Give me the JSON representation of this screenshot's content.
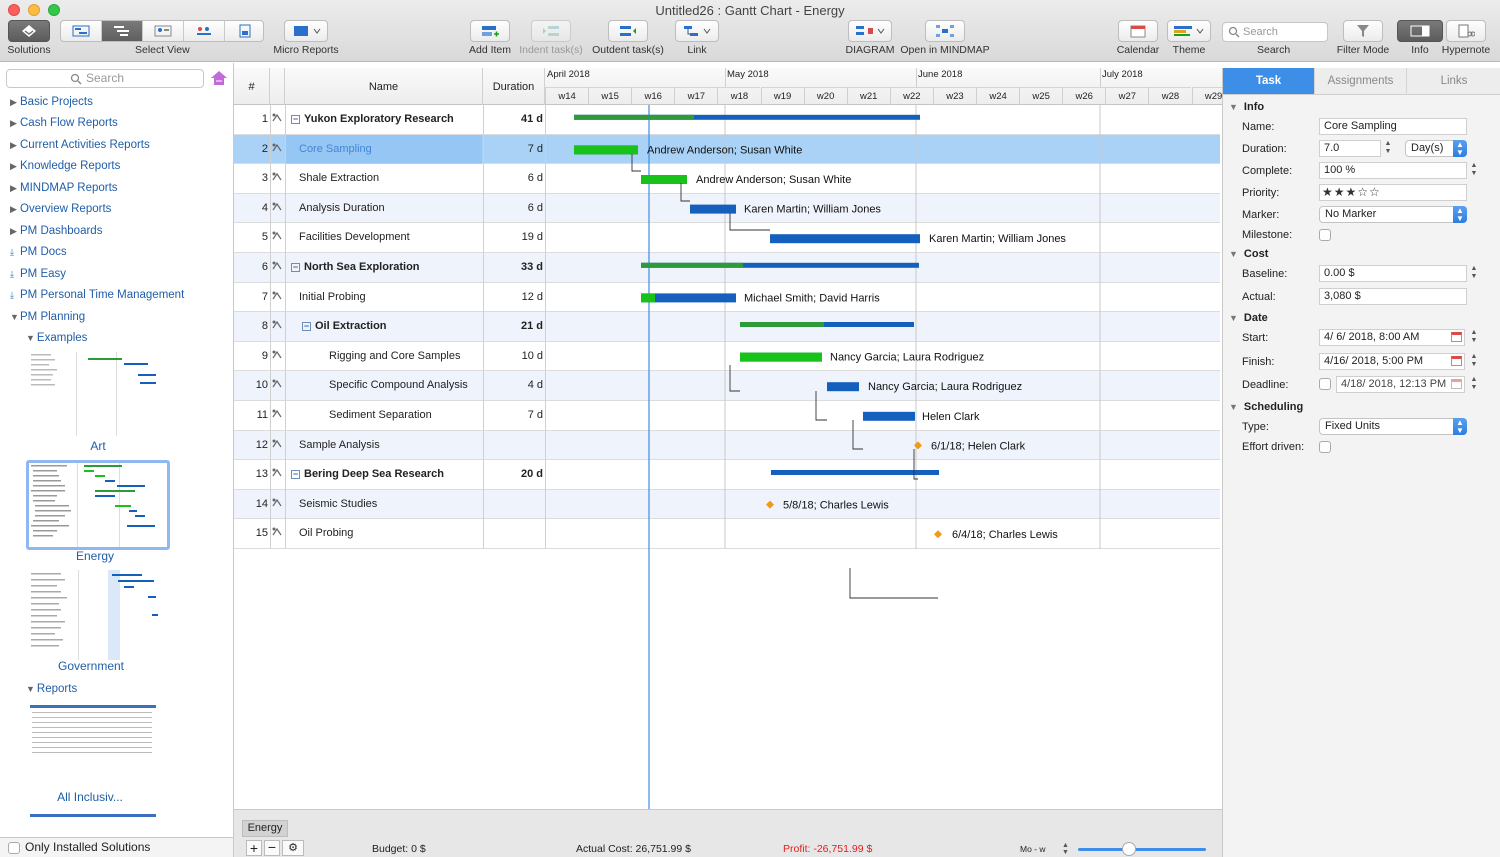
{
  "window": {
    "title": "Untitled26 : Gantt Chart - Energy"
  },
  "toolbar": {
    "solutions": "Solutions",
    "select_view": "Select View",
    "micro_reports": "Micro Reports",
    "add_item": "Add Item",
    "indent": "Indent task(s)",
    "outdent": "Outdent task(s)",
    "link": "Link",
    "diagram": "DIAGRAM",
    "open_mindmap": "Open in MINDMAP",
    "calendar": "Calendar",
    "theme": "Theme",
    "search_placeholder": "Search",
    "search_label": "Search",
    "filter_mode": "Filter Mode",
    "info": "Info",
    "hypernote": "Hypernote"
  },
  "sidebar": {
    "search_placeholder": "Search",
    "items": [
      {
        "label": "Basic Projects"
      },
      {
        "label": "Cash Flow Reports"
      },
      {
        "label": "Current Activities Reports"
      },
      {
        "label": "Knowledge Reports"
      },
      {
        "label": "MINDMAP Reports"
      },
      {
        "label": "Overview Reports"
      },
      {
        "label": "PM Dashboards"
      },
      {
        "label": "PM Docs"
      },
      {
        "label": "PM Easy"
      },
      {
        "label": "PM Personal Time Management"
      },
      {
        "label": "PM Planning"
      }
    ],
    "examples_label": "Examples",
    "thumbs": [
      {
        "label": "Art"
      },
      {
        "label": "Energy"
      },
      {
        "label": "Government"
      }
    ],
    "reports_label": "Reports",
    "report_thumbs": [
      {
        "label": "All Inclusiv..."
      }
    ],
    "only_installed": "Only Installed Solutions"
  },
  "grid": {
    "col_num": "#",
    "col_name": "Name",
    "col_duration": "Duration",
    "months": [
      "April 2018",
      "May 2018",
      "June 2018",
      "July 2018"
    ],
    "weeks": [
      "w14",
      "w15",
      "w16",
      "w17",
      "w18",
      "w19",
      "w20",
      "w21",
      "w22",
      "w23",
      "w24",
      "w25",
      "w26",
      "w27",
      "w28",
      "w29"
    ],
    "rows": [
      {
        "num": "1",
        "name": "Yukon Exploratory  Research",
        "duration": "41 d",
        "resources": ""
      },
      {
        "num": "2",
        "name": "Core Sampling",
        "duration": "7 d",
        "resources": "Andrew Anderson; Susan White"
      },
      {
        "num": "3",
        "name": "Shale Extraction",
        "duration": "6 d",
        "resources": "Andrew Anderson; Susan White"
      },
      {
        "num": "4",
        "name": "Analysis Duration",
        "duration": "6 d",
        "resources": "Karen Martin; William Jones"
      },
      {
        "num": "5",
        "name": "Facilities Development",
        "duration": "19 d",
        "resources": "Karen Martin; William Jones"
      },
      {
        "num": "6",
        "name": "North Sea Exploration",
        "duration": "33 d",
        "resources": ""
      },
      {
        "num": "7",
        "name": "Initial Probing",
        "duration": "12 d",
        "resources": "Michael Smith; David Harris"
      },
      {
        "num": "8",
        "name": "Oil  Extraction",
        "duration": "21 d",
        "resources": ""
      },
      {
        "num": "9",
        "name": "Rigging and Core Samples",
        "duration": "10 d",
        "resources": "Nancy Garcia; Laura Rodriguez"
      },
      {
        "num": "10",
        "name": "Specific Compound Analysis",
        "duration": "4 d",
        "resources": "Nancy Garcia; Laura Rodriguez"
      },
      {
        "num": "11",
        "name": "Sediment Separation",
        "duration": "7 d",
        "resources": "Helen Clark"
      },
      {
        "num": "12",
        "name": "Sample Analysis",
        "duration": "",
        "resources": "6/1/18; Helen Clark"
      },
      {
        "num": "13",
        "name": "Bering Deep Sea Research",
        "duration": "20 d",
        "resources": ""
      },
      {
        "num": "14",
        "name": "Seismic Studies",
        "duration": "",
        "resources": "5/8/18; Charles Lewis"
      },
      {
        "num": "15",
        "name": "Oil Probing",
        "duration": "",
        "resources": "6/4/18; Charles Lewis"
      }
    ]
  },
  "bottom": {
    "tab": "Energy",
    "budget": "Budget: 0 $",
    "actual_cost": "Actual Cost: 26,751.99 $",
    "profit": "Profit: -26,751.99 $",
    "zoom_label": "Mo - w"
  },
  "inspector": {
    "tabs": [
      "Task",
      "Assignments",
      "Links"
    ],
    "sections": {
      "info": "Info",
      "cost": "Cost",
      "date": "Date",
      "scheduling": "Scheduling"
    },
    "labels": {
      "name": "Name:",
      "duration": "Duration:",
      "complete": "Complete:",
      "priority": "Priority:",
      "marker": "Marker:",
      "milestone": "Milestone:",
      "baseline": "Baseline:",
      "actual": "Actual:",
      "start": "Start:",
      "finish": "Finish:",
      "deadline": "Deadline:",
      "type": "Type:",
      "effort": "Effort driven:"
    },
    "values": {
      "name": "Core Sampling",
      "duration": "7.0",
      "duration_unit": "Day(s)",
      "complete": "100 %",
      "priority_stars": 3,
      "priority_max": 5,
      "marker": "No Marker",
      "baseline": "0.00 $",
      "actual": "3,080 $",
      "start": "4/  6/ 2018,   8:00 AM",
      "finish": "4/16/ 2018,   5:00 PM",
      "deadline": "4/18/ 2018, 12:13 PM",
      "type": "Fixed Units"
    }
  },
  "colors": {
    "accent": "#3d8ee6",
    "complete": "#19c219",
    "remaining": "#1560bd",
    "summary_done": "#2e9a3a",
    "milestone": "#f39a12",
    "profit_negative": "#e02020"
  }
}
